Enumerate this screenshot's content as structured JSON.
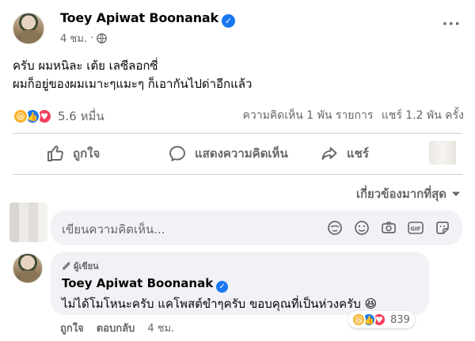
{
  "post": {
    "author": "Toey Apiwat Boonanak",
    "time": "4 ชม.",
    "dot": "·",
    "more": "···",
    "text_line1": "ครับ ผมหนิละ เต้ย เลซีลอกซี่",
    "text_line2": "ผมก็อยู่ของผมเมาะๆแมะๆ ก็เอากันไปด่าอีกแล้ว",
    "reaction_count": "5.6 หมื่น",
    "comments_summary": "ความคิดเห็น 1 พัน รายการ",
    "shares_summary": "แชร์ 1.2 พัน ครั้ง"
  },
  "actions": {
    "like": "ถูกใจ",
    "comment": "แสดงความคิดเห็น",
    "share": "แชร์"
  },
  "sort": {
    "label": "เกี่ยวข้องมากที่สุด"
  },
  "composer": {
    "placeholder": "เขียนความคิดเห็น..."
  },
  "comment": {
    "badge": "ผู้เขียน",
    "author": "Toey Apiwat Boonanak",
    "text": "ไม่ได้โมโหนะครับ แคโพสต์ขำๆครับ ขอบคุณที่เป็นห่วงครับ 😆",
    "like": "ถูกใจ",
    "reply": "ตอบกลับ",
    "time": "4 ชม.",
    "reaction_count": "839"
  },
  "colors": {
    "facebook_blue": "#1877f2",
    "muted_text": "#65676b",
    "surface": "#f0f2f5",
    "divider": "#ced0d4"
  }
}
